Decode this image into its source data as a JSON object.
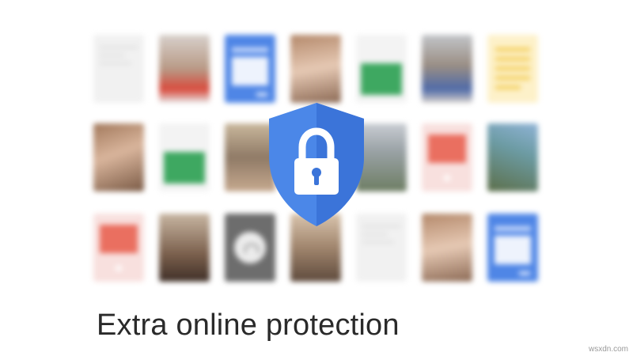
{
  "caption": "Extra online protection",
  "watermark": "wsxdn.com",
  "center_icon": {
    "shape": "shield-icon",
    "glyph": "lock-icon",
    "color": "#4b87e8"
  },
  "tiles": [
    "blank-document",
    "photo",
    "form",
    "photo",
    "spreadsheet",
    "photo",
    "note",
    "photo",
    "spreadsheet",
    "photo",
    "photo",
    "presentation",
    "photo",
    "presentation",
    "photo",
    "audio",
    "photo",
    "blank-document",
    "photo",
    "form"
  ]
}
